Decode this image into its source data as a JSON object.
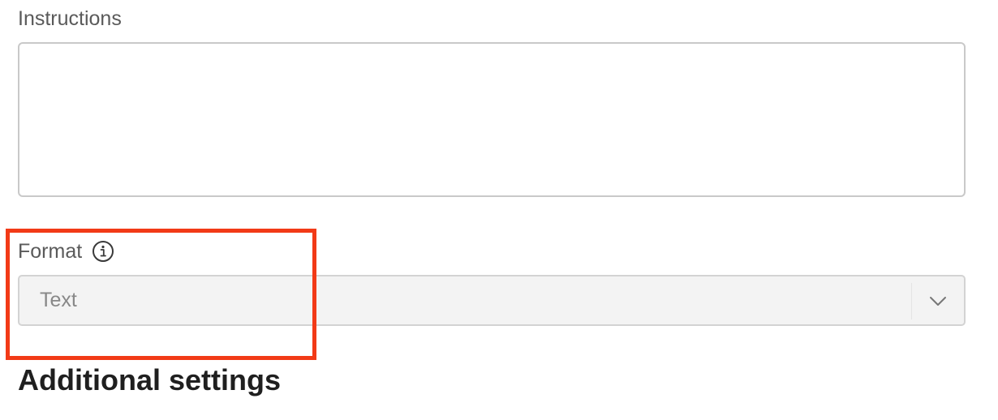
{
  "instructions": {
    "label": "Instructions",
    "value": "",
    "placeholder": ""
  },
  "format": {
    "label": "Format",
    "info_icon": "info-icon",
    "selected_value": "Text",
    "dropdown_icon": "chevron-down-icon"
  },
  "additional_settings": {
    "heading": "Additional settings"
  },
  "annotation": {
    "highlight_color": "#f23a17"
  }
}
